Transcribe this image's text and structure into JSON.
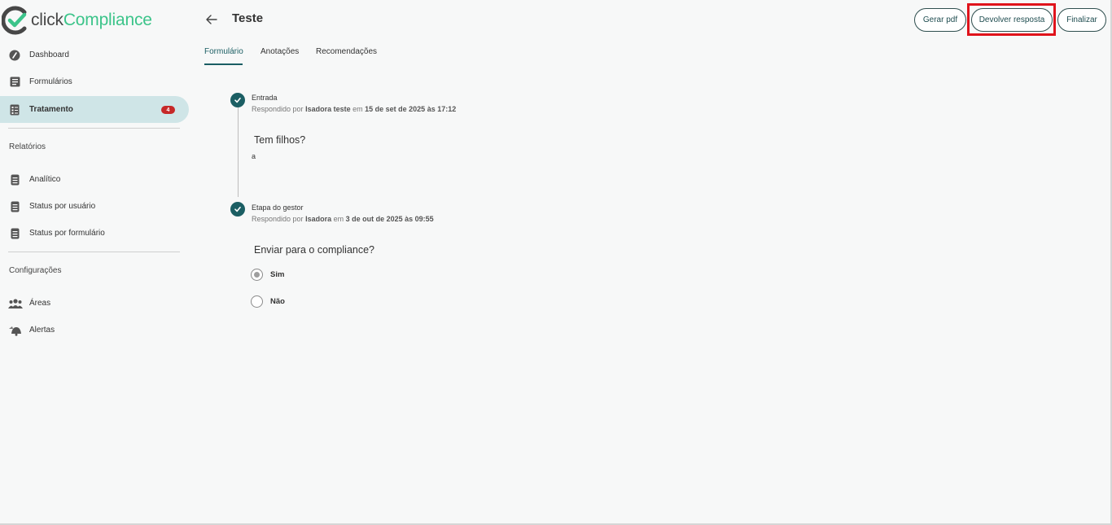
{
  "brand": {
    "word1": "click",
    "word2": "Compliance",
    "accent": "#3cc48a",
    "logo_icon": "check-c-logo-icon"
  },
  "sidebar": {
    "items": [
      {
        "label": "Dashboard",
        "icon": "dashboard-gauge-icon"
      },
      {
        "label": "Formulários",
        "icon": "form-list-icon"
      },
      {
        "label": "Tratamento",
        "icon": "checklist-icon",
        "badge": "4",
        "active": true
      }
    ],
    "reports_label": "Relatórios",
    "reports": [
      {
        "label": "Analítico",
        "icon": "report-doc-icon"
      },
      {
        "label": "Status por usuário",
        "icon": "report-doc-icon"
      },
      {
        "label": "Status por formulário",
        "icon": "report-doc-icon"
      }
    ],
    "config_label": "Configurações",
    "config": [
      {
        "label": "Áreas",
        "icon": "people-group-icon"
      },
      {
        "label": "Alertas",
        "icon": "bell-icon"
      }
    ]
  },
  "header": {
    "back_icon": "arrow-left-icon",
    "title": "Teste",
    "buttons": {
      "pdf": "Gerar pdf",
      "return": "Devolver resposta",
      "finish": "Finalizar"
    }
  },
  "tabs": [
    "Formulário",
    "Anotações",
    "Recomendações"
  ],
  "timeline": {
    "steps": [
      {
        "title": "Entrada",
        "meta_prefix": "Respondido por",
        "user": "Isadora teste",
        "meta_mid": "em",
        "date": "15 de set de 2025 às 17:12",
        "question": "Tem filhos?",
        "answer": "a"
      },
      {
        "title": "Etapa do gestor",
        "meta_prefix": "Respondido por",
        "user": "Isadora",
        "meta_mid": "em",
        "date": "3 de out de 2025 às 09:55",
        "question": "Enviar para o compliance?",
        "options": [
          {
            "label": "Sim",
            "selected": true
          },
          {
            "label": "Não",
            "selected": false
          }
        ]
      }
    ]
  },
  "colors": {
    "primary": "#1b5e63",
    "active_bg": "#cfe5e7",
    "badge": "#c62828",
    "highlight": "#e0131b"
  }
}
